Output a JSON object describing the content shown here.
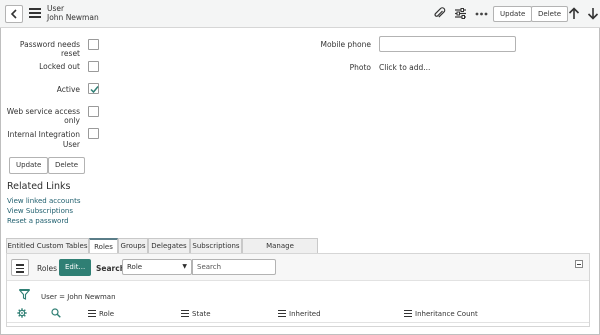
{
  "header": {
    "form_name": "User",
    "record_name": "John Newman",
    "update_label": "Update",
    "delete_label": "Delete"
  },
  "form": {
    "fields": [
      {
        "label": "Password needs reset",
        "checked": false
      },
      {
        "label": "Locked out",
        "checked": false
      },
      {
        "label": "Active",
        "checked": true
      },
      {
        "label": "Web service access only",
        "checked": false
      },
      {
        "label_line1": "Internal Integration",
        "label_line2": "User",
        "checked": false
      }
    ],
    "mobile_phone_label": "Mobile phone",
    "mobile_phone_value": "",
    "photo_label": "Photo",
    "photo_action": "Click to add...",
    "update_label": "Update",
    "delete_label": "Delete"
  },
  "related_links": {
    "title": "Related Links",
    "links": [
      "View linked accounts",
      "View Subscriptions",
      "Reset a password"
    ]
  },
  "tabs": [
    "Entitled Custom Tables",
    "Roles",
    "Groups",
    "Delegates",
    "Subscriptions",
    "Manage Subscriptions"
  ],
  "active_tab": "Roles",
  "related_list": {
    "title": "Roles",
    "edit_label": "Edit...",
    "search_label": "Search",
    "search_field": "Role",
    "search_placeholder": "Search",
    "filter": "User = John Newman",
    "columns": [
      "Role",
      "State",
      "Inherited",
      "Inheritance Count"
    ]
  },
  "colors": {
    "accent": "#2f7f74",
    "link": "#1f5f6e",
    "header_bg": "#f4f5f5"
  }
}
